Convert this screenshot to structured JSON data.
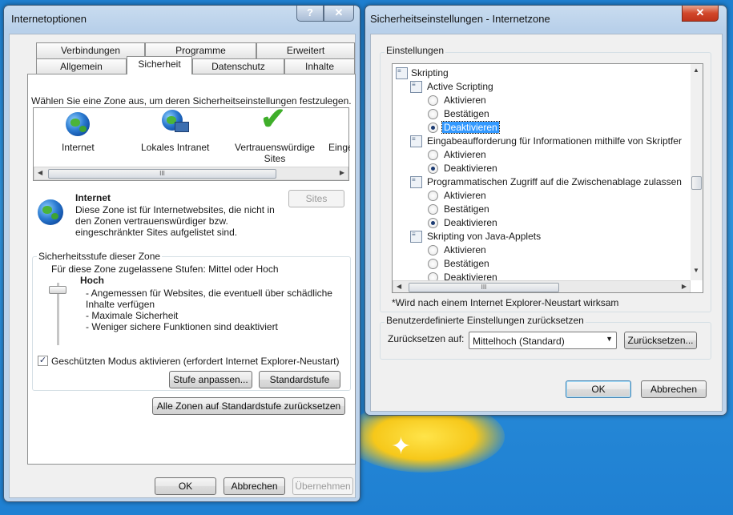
{
  "left": {
    "title": "Internetoptionen",
    "help": "?",
    "close": "✕",
    "tabs_row1": [
      "Verbindungen",
      "Programme",
      "Erweitert"
    ],
    "tabs_row2": [
      "Allgemein",
      "Sicherheit",
      "Datenschutz",
      "Inhalte"
    ],
    "zone_prompt": "Wählen Sie eine Zone aus, um deren Sicherheitseinstellungen festzulegen.",
    "zones": [
      {
        "label": "Internet",
        "icon": "globe-icon"
      },
      {
        "label": "Lokales Intranet",
        "icon": "intranet-icon"
      },
      {
        "label": "Vertrauenswürdige Sites",
        "icon": "check-icon"
      },
      {
        "label": "Einge",
        "icon": "restricted-icon"
      }
    ],
    "zone_title": "Internet",
    "zone_desc": [
      "Diese Zone ist für Internetwebsites, die nicht in",
      "den Zonen vertrauenswürdiger bzw.",
      "eingeschränkter Sites aufgelistet sind."
    ],
    "sites_button": "Sites",
    "level_group": "Sicherheitsstufe dieser Zone",
    "allowed": "Für diese Zone zugelassene Stufen: Mittel oder Hoch",
    "level_name": "Hoch",
    "level_points": [
      "- Angemessen für Websites, die eventuell über schädliche",
      "Inhalte verfügen",
      "- Maximale Sicherheit",
      "- Weniger sichere Funktionen sind deaktiviert"
    ],
    "protected_mode": "Geschützten Modus aktivieren (erfordert Internet Explorer-Neustart)",
    "protected_checked": "✓",
    "custom_level": "Stufe anpassen...",
    "default_level": "Standardstufe",
    "reset_all": "Alle Zonen auf Standardstufe zurücksetzen",
    "ok": "OK",
    "cancel": "Abbrechen",
    "apply": "Übernehmen",
    "scroll_grip": "III"
  },
  "right": {
    "title": "Sicherheitseinstellungen - Internetzone",
    "close": "✕",
    "settings_group": "Einstellungen",
    "root": "Skripting",
    "items": [
      {
        "heading": "Active Scripting",
        "options": [
          "Aktivieren",
          "Bestätigen",
          "Deaktivieren"
        ],
        "selected": 2
      },
      {
        "heading": "Eingabeaufforderung für Informationen mithilfe von Skriptfer",
        "options": [
          "Aktivieren",
          "Deaktivieren"
        ],
        "selected": 1
      },
      {
        "heading": "Programmatischen Zugriff auf die Zwischenablage zulassen",
        "options": [
          "Aktivieren",
          "Bestätigen",
          "Deaktivieren"
        ],
        "selected": 2
      },
      {
        "heading": "Skripting von Java-Applets",
        "options": [
          "Aktivieren",
          "Bestätigen",
          "Deaktivieren"
        ],
        "selected": -1
      }
    ],
    "restart_note": "*Wird nach einem Internet Explorer-Neustart wirksam",
    "reset_group": "Benutzerdefinierte Einstellungen zurücksetzen",
    "reset_to": "Zurücksetzen auf:",
    "reset_value": "Mittelhoch (Standard)",
    "reset_button": "Zurücksetzen...",
    "ok": "OK",
    "cancel": "Abbrechen",
    "scroll_grip": "III"
  }
}
